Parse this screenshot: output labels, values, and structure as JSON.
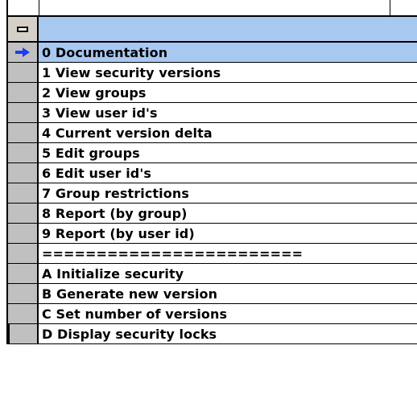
{
  "grid": {
    "header": {
      "collapse_symbol": "minus"
    },
    "rows": [
      {
        "label": "0 Documentation",
        "selected": true
      },
      {
        "label": "1 View security versions",
        "selected": false
      },
      {
        "label": "2 View groups",
        "selected": false
      },
      {
        "label": "3 View user id's",
        "selected": false
      },
      {
        "label": "4 Current version delta",
        "selected": false
      },
      {
        "label": "5 Edit groups",
        "selected": false
      },
      {
        "label": "6 Edit user id's",
        "selected": false
      },
      {
        "label": "7 Group restrictions",
        "selected": false
      },
      {
        "label": "8 Report (by group)",
        "selected": false
      },
      {
        "label": "9 Report (by user id)",
        "selected": false
      },
      {
        "label": "========================",
        "selected": false
      },
      {
        "label": "A Initialize security",
        "selected": false
      },
      {
        "label": "B Generate new version",
        "selected": false
      },
      {
        "label": "C Set number of versions",
        "selected": false
      },
      {
        "label": "D Display security locks",
        "selected": false
      }
    ],
    "colors": {
      "selection": "#a8c8f0",
      "selector_bg": "#c0c0c0",
      "arrow": "#1e3cf0"
    },
    "icons": {
      "current_row": "right-arrow-icon",
      "collapse": "minus-icon"
    }
  }
}
